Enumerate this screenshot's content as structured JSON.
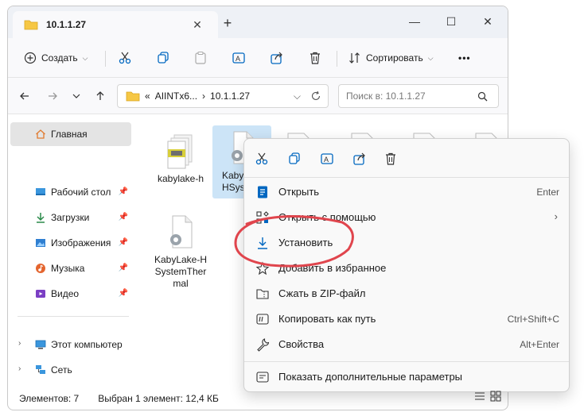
{
  "window": {
    "tab_title": "10.1.1.27",
    "tab_close": "✕",
    "new_tab": "+",
    "minimize": "—",
    "maximize": "☐",
    "close": "✕"
  },
  "toolbar": {
    "create_label": "Создать",
    "sort_label": "Сортировать",
    "more": "•••"
  },
  "address": {
    "prefix": "«",
    "segment1": "AIINTx6...",
    "separator": "›",
    "segment2": "10.1.1.27",
    "search_placeholder": "Поиск в: 10.1.1.27"
  },
  "sidebar": {
    "home": "Главная",
    "items": [
      {
        "label": "Рабочий стол",
        "icon": "desktop-icon"
      },
      {
        "label": "Загрузки",
        "icon": "download-icon"
      },
      {
        "label": "Изображения",
        "icon": "pictures-icon"
      },
      {
        "label": "Музыка",
        "icon": "music-icon"
      },
      {
        "label": "Видео",
        "icon": "video-icon"
      }
    ],
    "this_pc": "Этот компьютер",
    "network": "Сеть"
  },
  "files": [
    {
      "name": "kabylake-h"
    },
    {
      "name": "KabyLake-HSyste"
    },
    {
      "name": "KabyLake-HSystemThermal"
    }
  ],
  "status": {
    "count": "Элементов: 7",
    "selected": "Выбран 1 элемент: 12,4 КБ"
  },
  "context_menu": {
    "items": [
      {
        "label": "Открыть",
        "shortcut": "Enter"
      },
      {
        "label": "Открыть с помощью",
        "shortcut": ""
      },
      {
        "label": "Установить",
        "shortcut": ""
      },
      {
        "label": "Добавить в избранное",
        "shortcut": ""
      },
      {
        "label": "Сжать в ZIP-файл",
        "shortcut": ""
      },
      {
        "label": "Копировать как путь",
        "shortcut": "Ctrl+Shift+C"
      },
      {
        "label": "Свойства",
        "shortcut": "Alt+Enter"
      },
      {
        "label": "Показать дополнительные параметры",
        "shortcut": ""
      }
    ],
    "submenu_arrow": "›"
  },
  "colors": {
    "accent": "#0067c0",
    "highlight_ring": "#e0454d"
  }
}
